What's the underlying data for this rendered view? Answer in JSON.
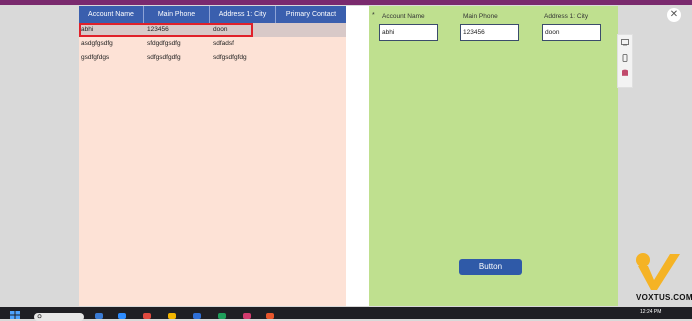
{
  "gallery": {
    "columns": [
      "Account Name",
      "Main Phone",
      "Address 1: City",
      "Primary Contact"
    ],
    "rows": [
      {
        "name": "abhi",
        "phone": "123456",
        "city": "doon",
        "contact": ""
      },
      {
        "name": "asdgfgsdfg",
        "phone": "sfdgdfgsdfg",
        "city": "sdfadsf",
        "contact": ""
      },
      {
        "name": "gsdfgfdgs",
        "phone": "sdfgsdfgdfg",
        "city": "sdfgsdfgfdg",
        "contact": ""
      }
    ]
  },
  "form": {
    "required_mark": "*",
    "fields": [
      {
        "label": "Account Name",
        "value": "abhi"
      },
      {
        "label": "Main Phone",
        "value": "123456"
      },
      {
        "label": "Address 1: City",
        "value": "doon"
      }
    ],
    "button_label": "Button"
  },
  "watermark": {
    "text": "VOXTUS.COM"
  },
  "taskbar": {
    "time": "12:24 PM"
  },
  "colors": {
    "header": "#3a5fae",
    "gallery_bg": "#fde2d6",
    "form_bg": "#bfe08f",
    "selection": "#e0202a",
    "button": "#2f5aa8"
  },
  "icons": [
    "close-icon",
    "tree-view-icon",
    "mobile-icon",
    "database-icon",
    "windows-icon",
    "search-icon"
  ]
}
